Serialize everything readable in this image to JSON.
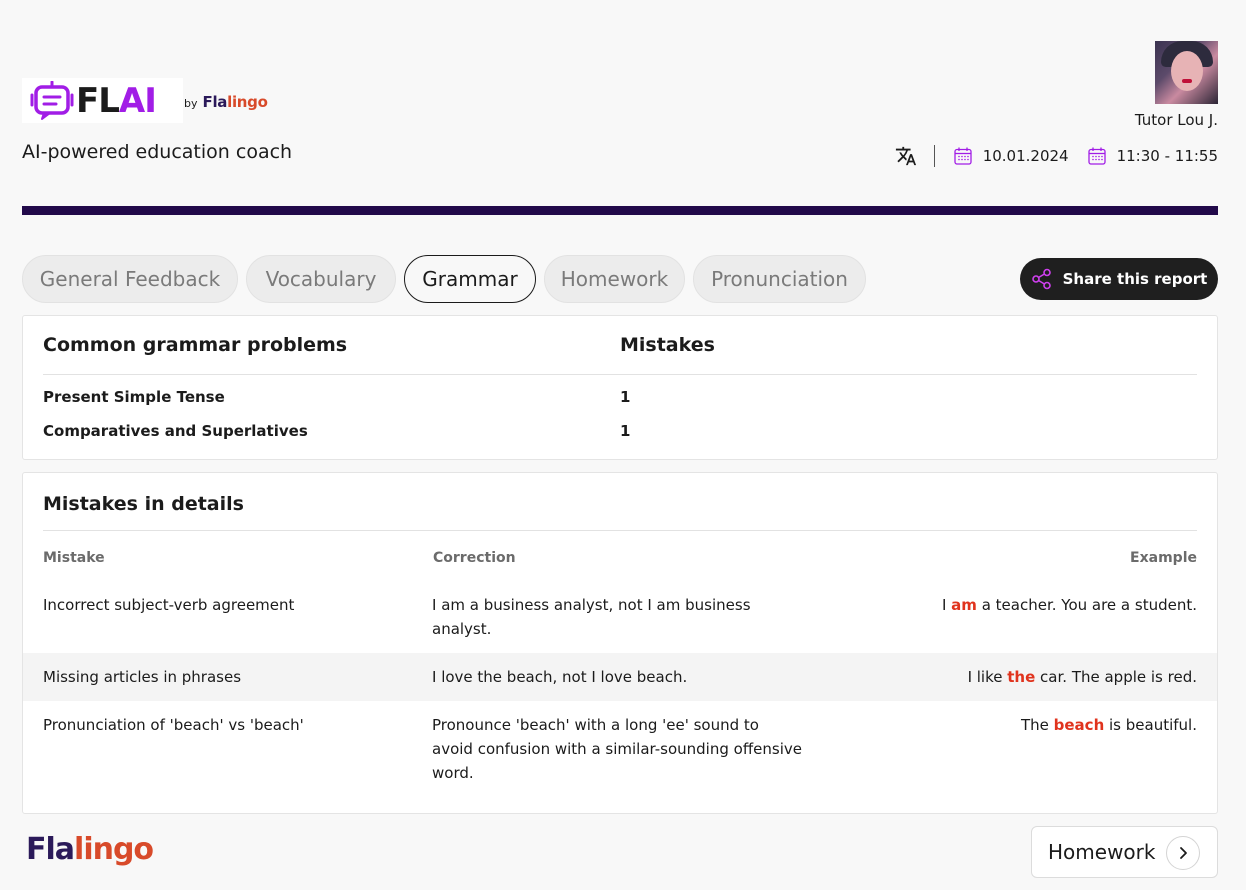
{
  "brand": {
    "logo_f": "FL",
    "logo_ai": "AI",
    "by": "by",
    "brand_fla": "Fla",
    "brand_lingo": "lingo",
    "subtitle": "AI-powered education coach"
  },
  "tutor": {
    "name": "Tutor Lou J."
  },
  "meta": {
    "date": "10.01.2024",
    "time": "11:30 - 11:55"
  },
  "tabs": [
    {
      "label": "General Feedback"
    },
    {
      "label": "Vocabulary"
    },
    {
      "label": "Grammar"
    },
    {
      "label": "Homework"
    },
    {
      "label": "Pronunciation"
    }
  ],
  "share": {
    "label": "Share this report"
  },
  "problems": {
    "col1": "Common grammar problems",
    "col2": "Mistakes",
    "rows": [
      {
        "name": "Present Simple Tense",
        "count": "1"
      },
      {
        "name": "Comparatives and Superlatives",
        "count": "1"
      }
    ]
  },
  "details": {
    "title": "Mistakes in details",
    "col_mistake": "Mistake",
    "col_correction": "Correction",
    "col_example": "Example",
    "rows": [
      {
        "mistake": "Incorrect subject-verb agreement",
        "correction": "I am a business analyst, not I am business analyst.",
        "ex_pre": "I ",
        "ex_hl": "am",
        "ex_post": " a teacher. You are a student."
      },
      {
        "mistake": "Missing articles in phrases",
        "correction": "I love the beach, not I love beach.",
        "ex_pre": "I like ",
        "ex_hl": "the",
        "ex_post": " car. The apple is red."
      },
      {
        "mistake": "Pronunciation of 'beach' vs 'beach'",
        "correction": "Pronounce 'beach' with a long 'ee' sound to avoid confusion with a similar-sounding offensive word.",
        "ex_pre": "The ",
        "ex_hl": "beach",
        "ex_post": " is beautiful."
      }
    ]
  },
  "footer": {
    "logo_fla": "Fla",
    "logo_lingo": "lingo",
    "next_label": "Homework",
    "next_icon": "chevron-right-icon"
  },
  "colors": {
    "accent_purple": "#a11de6",
    "divider": "#220a4a",
    "highlight": "#e0331d",
    "brand_orange": "#d84a2a"
  }
}
